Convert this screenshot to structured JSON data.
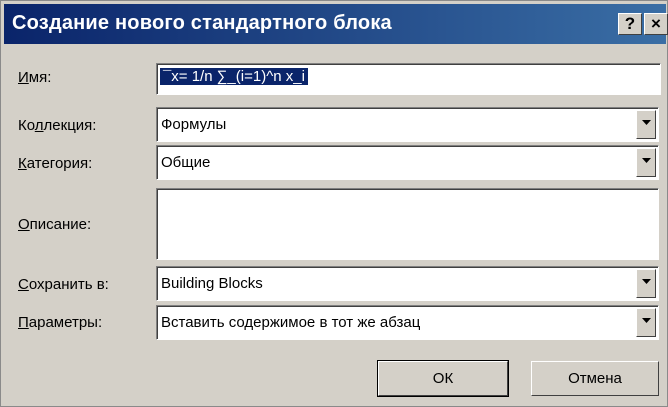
{
  "window": {
    "title": "Создание нового стандартного блока",
    "help_label": "?",
    "close_label": "×"
  },
  "form": {
    "name": {
      "label_accel": "И",
      "label_rest": "мя:",
      "value": "¯x=  1/n ∑_(i=1)^n x_i"
    },
    "collection": {
      "label_pre": "Ко",
      "label_accel": "л",
      "label_rest": "лекция:",
      "value": "Формулы"
    },
    "category": {
      "label_accel": "К",
      "label_rest": "атегория:",
      "value": "Общие"
    },
    "description": {
      "label_accel": "О",
      "label_rest": "писание:",
      "value": ""
    },
    "save_in": {
      "label_accel": "С",
      "label_rest": "охранить в:",
      "value": "Building Blocks"
    },
    "options": {
      "label_accel": "П",
      "label_rest": "араметры:",
      "value": "Вставить содержимое в тот же абзац"
    }
  },
  "buttons": {
    "ok": "ОК",
    "cancel": "Отмена"
  },
  "colors": {
    "titlebar_start": "#0a246a",
    "titlebar_end": "#3a6ea5",
    "dialog_bg": "#d4d0c8"
  }
}
